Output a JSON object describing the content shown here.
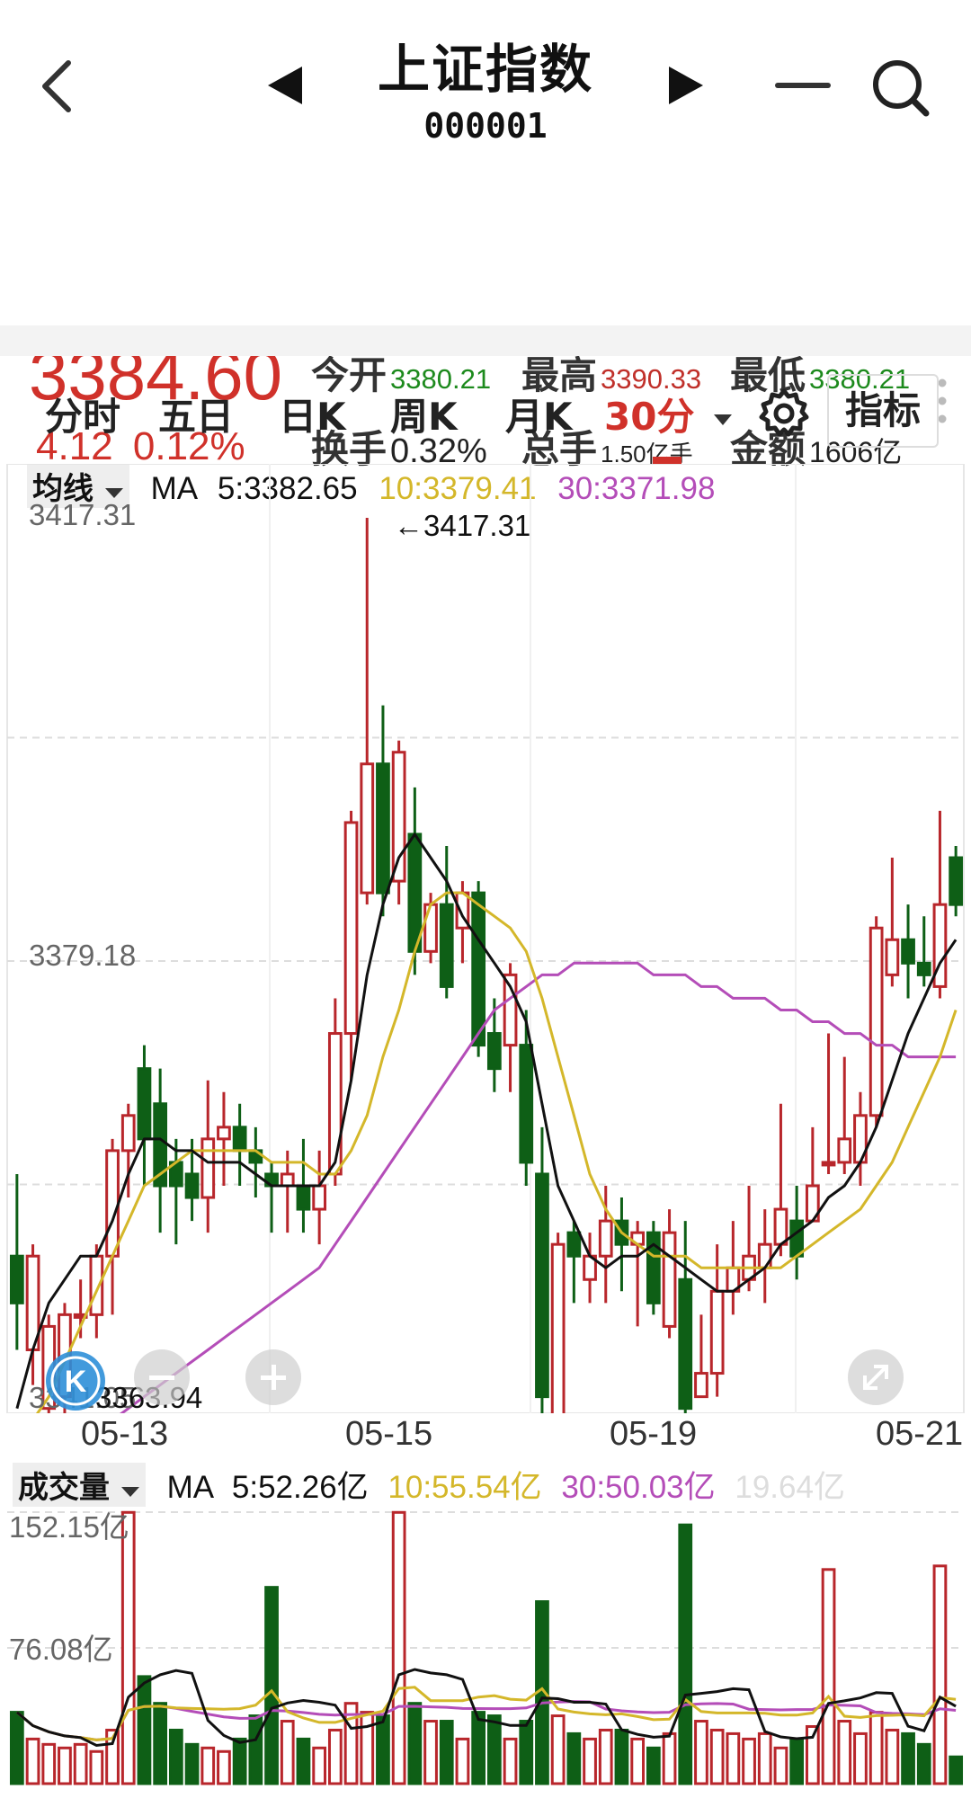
{
  "header": {
    "title": "上证指数",
    "code": "000001"
  },
  "quote": {
    "price": "3384.60",
    "change": "4.12",
    "change_pct": "0.12%",
    "open_label": "今开",
    "open": "3380.21",
    "high_label": "最高",
    "high": "3390.33",
    "low_label": "最低",
    "low": "3380.21",
    "turnover_label": "换手",
    "turnover": "0.32%",
    "volume_label": "总手",
    "volume": "1.50亿手",
    "amount_label": "金额",
    "amount": "1606亿"
  },
  "tabs": [
    {
      "label": "分时"
    },
    {
      "label": "五日"
    },
    {
      "label": "日K"
    },
    {
      "label": "周K"
    },
    {
      "label": "月K"
    },
    {
      "label": "30分"
    }
  ],
  "indicator_button": "指标",
  "colors": {
    "up": "#b8262b",
    "down": "#0e5f16",
    "price_red": "#d0312a",
    "ma5": "#111111",
    "ma10": "#d4b72a",
    "ma30": "#b44db8"
  },
  "icons": [
    "back-arrow-icon",
    "prev-stock-icon",
    "next-stock-icon",
    "minus-icon",
    "search-icon",
    "more-dots-icon",
    "dropdown-caret-icon",
    "settings-gear-icon",
    "k-logo-icon",
    "zoom-out-icon",
    "zoom-in-icon",
    "fullscreen-icon"
  ],
  "price_chart": {
    "legend_label": "均线",
    "ma_label": "MA",
    "ma5": "5:3382.65",
    "ma10": "10:3379.41",
    "ma30": "30:3371.98",
    "y_max_label": "3417.31",
    "y_mid_label": "3379.18",
    "y_min_label": "3341.05",
    "high_marker": "3417.31",
    "low_marker": "3363.94",
    "dates": [
      "05-13",
      "05-15",
      "05-19",
      "05-21"
    ]
  },
  "volume_chart": {
    "legend_label": "成交量",
    "ma_label": "MA",
    "ma5": "5:52.26亿",
    "ma10": "10:55.54亿",
    "ma30": "30:50.03亿",
    "extra": "19.64亿",
    "y_max_label": "152.15亿",
    "y_mid_label": "76.08亿"
  },
  "chart_data": {
    "type": "candlestick",
    "ylim": [
      3341.05,
      3417.31
    ],
    "candles": [
      [
        3354,
        3350,
        3361,
        3346
      ],
      [
        3346,
        3354,
        3355,
        3343
      ],
      [
        3341,
        3348,
        3349,
        3338
      ],
      [
        3342,
        3349,
        3350,
        3340
      ],
      [
        3349,
        3349,
        3352,
        3347
      ],
      [
        3349,
        3354,
        3355,
        3347
      ],
      [
        3354,
        3363,
        3364,
        3349
      ],
      [
        3363,
        3366,
        3367,
        3359
      ],
      [
        3370,
        3364,
        3372,
        3360
      ],
      [
        3367,
        3360,
        3370,
        3356
      ],
      [
        3362,
        3360,
        3364,
        3355
      ],
      [
        3361,
        3359,
        3364,
        3357
      ],
      [
        3359,
        3364,
        3369,
        3356
      ],
      [
        3364,
        3365,
        3368,
        3360
      ],
      [
        3365,
        3363,
        3367,
        3360
      ],
      [
        3363,
        3362,
        3365,
        3359
      ],
      [
        3361,
        3360,
        3362,
        3356
      ],
      [
        3360,
        3361,
        3363,
        3356
      ],
      [
        3360,
        3358,
        3364,
        3356
      ],
      [
        3358,
        3360,
        3363,
        3355
      ],
      [
        3361,
        3373,
        3376,
        3360
      ],
      [
        3373,
        3391,
        3392,
        3369
      ],
      [
        3385,
        3396,
        3417,
        3384
      ],
      [
        3396,
        3385,
        3401,
        3383
      ],
      [
        3386,
        3397,
        3398,
        3384
      ],
      [
        3390,
        3380,
        3394,
        3378
      ],
      [
        3380,
        3384,
        3385,
        3379
      ],
      [
        3384,
        3377,
        3389,
        3376
      ],
      [
        3382,
        3385,
        3386,
        3379
      ],
      [
        3385,
        3372,
        3386,
        3371
      ],
      [
        3373,
        3370,
        3376,
        3368
      ],
      [
        3372,
        3378,
        3379,
        3368
      ],
      [
        3372,
        3362,
        3375,
        3360
      ],
      [
        3361,
        3342,
        3365,
        3339
      ],
      [
        3340,
        3355,
        3356,
        3339
      ],
      [
        3356,
        3354,
        3357,
        3350
      ],
      [
        3352,
        3354,
        3356,
        3350
      ],
      [
        3354,
        3357,
        3360,
        3350
      ],
      [
        3357,
        3355,
        3359,
        3351
      ],
      [
        3355,
        3356,
        3357,
        3348
      ],
      [
        3356,
        3350,
        3357,
        3349
      ],
      [
        3348,
        3356,
        3358,
        3347
      ],
      [
        3352,
        3341,
        3357,
        3340
      ],
      [
        3342,
        3344,
        3349,
        3343
      ],
      [
        3344,
        3351,
        3355,
        3342
      ],
      [
        3351,
        3353,
        3357,
        3349
      ],
      [
        3352,
        3354,
        3360,
        3351
      ],
      [
        3353,
        3355,
        3358,
        3350
      ],
      [
        3355,
        3358,
        3367,
        3354
      ],
      [
        3357,
        3354,
        3360,
        3352
      ],
      [
        3357,
        3360,
        3365,
        3357
      ],
      [
        3362,
        3362,
        3373,
        3361
      ],
      [
        3362,
        3364,
        3371,
        3361
      ],
      [
        3362,
        3366,
        3368,
        3360
      ],
      [
        3366,
        3382,
        3383,
        3365
      ],
      [
        3378,
        3381,
        3388,
        3377
      ],
      [
        3381,
        3379,
        3384,
        3376
      ],
      [
        3379,
        3378,
        3383,
        3377
      ],
      [
        3377,
        3384,
        3392,
        3376
      ],
      [
        3388,
        3384,
        3389,
        3383
      ]
    ],
    "ma5": [
      3341,
      3346,
      3350,
      3352,
      3354,
      3354,
      3357,
      3361,
      3364,
      3364,
      3363,
      3363,
      3362,
      3362,
      3362,
      3361,
      3360,
      3360,
      3360,
      3360,
      3362,
      3369,
      3378,
      3384,
      3388,
      3390,
      3388,
      3386,
      3383,
      3381,
      3379,
      3377,
      3374,
      3367,
      3360,
      3357,
      3354,
      3353,
      3354,
      3354,
      3355,
      3354,
      3353,
      3352,
      3351,
      3351,
      3352,
      3353,
      3355,
      3356,
      3357,
      3359,
      3360,
      3362,
      3365,
      3369,
      3373,
      3376,
      3379,
      3381
    ],
    "ma10": [
      3337,
      3340,
      3342,
      3345,
      3348,
      3351,
      3354,
      3357,
      3360,
      3361,
      3362,
      3363,
      3363,
      3363,
      3363,
      3363,
      3362,
      3362,
      3362,
      3361,
      3361,
      3363,
      3366,
      3371,
      3375,
      3380,
      3384,
      3385,
      3385,
      3384,
      3383,
      3382,
      3380,
      3376,
      3371,
      3366,
      3361,
      3358,
      3356,
      3355,
      3354,
      3354,
      3354,
      3353,
      3353,
      3353,
      3353,
      3353,
      3353,
      3354,
      3355,
      3356,
      3357,
      3358,
      3360,
      3362,
      3365,
      3368,
      3371,
      3375
    ],
    "ma30": [
      3328,
      3330,
      3332,
      3334,
      3336,
      3338,
      3340,
      3341,
      3342,
      3343,
      3344,
      3345,
      3346,
      3347,
      3348,
      3349,
      3350,
      3351,
      3352,
      3353,
      3355,
      3357,
      3359,
      3361,
      3363,
      3365,
      3367,
      3369,
      3371,
      3373,
      3375,
      3376,
      3377,
      3378,
      3378,
      3379,
      3379,
      3379,
      3379,
      3379,
      3378,
      3378,
      3378,
      3377,
      3377,
      3376,
      3376,
      3376,
      3375,
      3375,
      3374,
      3374,
      3373,
      3373,
      3372,
      3372,
      3371,
      3371,
      3371,
      3371
    ],
    "volume": [
      40,
      25,
      22,
      20,
      22,
      18,
      30,
      152,
      60,
      45,
      30,
      22,
      20,
      18,
      25,
      38,
      110,
      35,
      25,
      20,
      30,
      45,
      40,
      38,
      152,
      45,
      35,
      35,
      25,
      40,
      38,
      25,
      35,
      102,
      38,
      28,
      25,
      30,
      30,
      25,
      20,
      28,
      145,
      35,
      30,
      28,
      25,
      28,
      20,
      25,
      32,
      120,
      35,
      28,
      40,
      30,
      28,
      22,
      122,
      15
    ],
    "volume_ylim": [
      0,
      152.15
    ]
  }
}
